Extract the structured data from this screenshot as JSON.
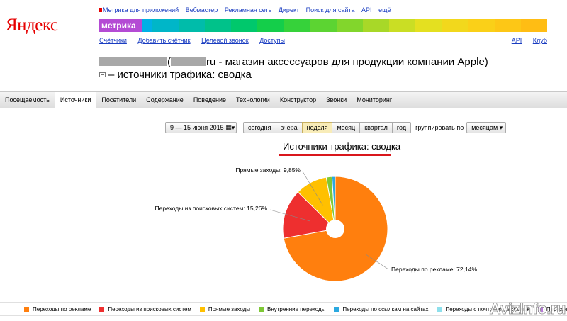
{
  "header": {
    "logo_text": "Яндекс",
    "top_links": [
      "Метрика для приложений",
      "Вебмастер",
      "Рекламная сеть",
      "Директ",
      "Поиск для сайта",
      "API",
      "ещё"
    ],
    "product": "метрика",
    "sub_links_left": [
      "Счётчики",
      "Добавить счётчик",
      "Целевой звонок",
      "Доступы"
    ],
    "sub_links_right": [
      "API",
      "Клуб"
    ],
    "rainbow_colors": [
      "#00aaee",
      "#00b0e6",
      "#00b6c8",
      "#00bcaa",
      "#00c28a",
      "#00c86c",
      "#14ce4a",
      "#36d23a",
      "#5cd432",
      "#82d62c",
      "#a8d828",
      "#cade24",
      "#e4e020",
      "#f2d81c",
      "#fad018",
      "#fdc716",
      "#ffbd14"
    ]
  },
  "page": {
    "title_paren_open": "(",
    "title_rest": "ru - магазин аксессуаров для продукции компании Apple)",
    "subtitle": "– источники трафика: сводка"
  },
  "menu": {
    "items": [
      "Посещаемость",
      "Источники",
      "Посетители",
      "Содержание",
      "Поведение",
      "Технологии",
      "Конструктор",
      "Звонки",
      "Мониторинг"
    ],
    "active": "Источники"
  },
  "controls": {
    "date_range": "9 — 15 июня 2015",
    "periods": [
      "сегодня",
      "вчера",
      "неделя",
      "месяц",
      "квартал",
      "год"
    ],
    "active_period": "неделя",
    "group_label": "группировать по",
    "group_value": "месяцам"
  },
  "chart_data": {
    "type": "pie",
    "title": "Источники трафика: сводка",
    "slices": [
      {
        "name": "Переходы по рекламе",
        "value": 72.14,
        "color": "#ff7f0e",
        "label": "Переходы по рекламе: 72,14%"
      },
      {
        "name": "Переходы из поисковых систем",
        "value": 15.26,
        "color": "#ee2f2f",
        "label": "Переходы из поисковых систем: 15,26%"
      },
      {
        "name": "Прямые заходы",
        "value": 9.85,
        "color": "#ffc000",
        "label": "Прямые заходы: 9,85%"
      },
      {
        "name": "Внутренние переходы",
        "value": 1.75,
        "color": "#7ec836",
        "label": ""
      },
      {
        "name": "Переходы по ссылкам на сайтах",
        "value": 1.0,
        "color": "#2ba9e0",
        "label": ""
      }
    ],
    "legend": [
      {
        "name": "Переходы по рекламе",
        "color": "#ff7f0e"
      },
      {
        "name": "Переходы из поисковых систем",
        "color": "#ee2f2f"
      },
      {
        "name": "Прямые заходы",
        "color": "#ffc000"
      },
      {
        "name": "Внутренние переходы",
        "color": "#7ec836"
      },
      {
        "name": "Переходы по ссылкам на сайтах",
        "color": "#2ba9e0"
      },
      {
        "name": "Переходы с почтовых рассылок",
        "color": "#8ee0ec"
      },
      {
        "name": "Переходы из социальных сетей",
        "color": "#b77ad8"
      }
    ]
  },
  "watermark": "AvizInfo.ru"
}
